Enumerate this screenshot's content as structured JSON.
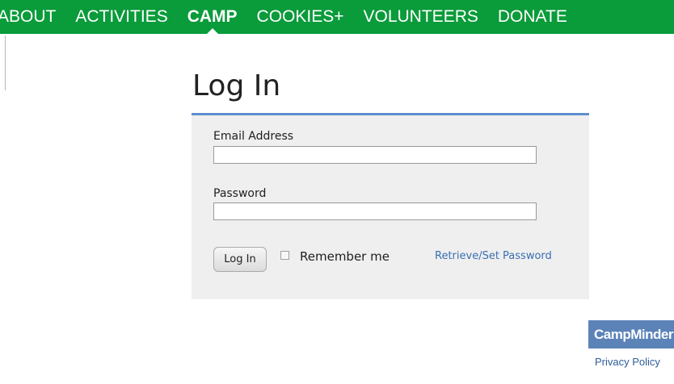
{
  "nav": {
    "items": [
      "ABOUT",
      "ACTIVITIES",
      "CAMP",
      "COOKIES+",
      "VOLUNTEERS",
      "DONATE"
    ],
    "active": "CAMP"
  },
  "login": {
    "title": "Log In",
    "email_label": "Email Address",
    "email_value": "",
    "password_label": "Password",
    "password_value": "",
    "button_label": "Log In",
    "remember_label": "Remember me",
    "remember_checked": false,
    "retrieve_link": "Retrieve/Set Password"
  },
  "footer": {
    "logo_text": "CampMinder",
    "privacy_link": "Privacy Policy"
  },
  "colors": {
    "nav_bg": "#0a9b3a",
    "accent_rule": "#5d8fd0",
    "panel_bg": "#efefef",
    "link": "#3a6fb0",
    "logo_bg": "#5b83b8"
  }
}
